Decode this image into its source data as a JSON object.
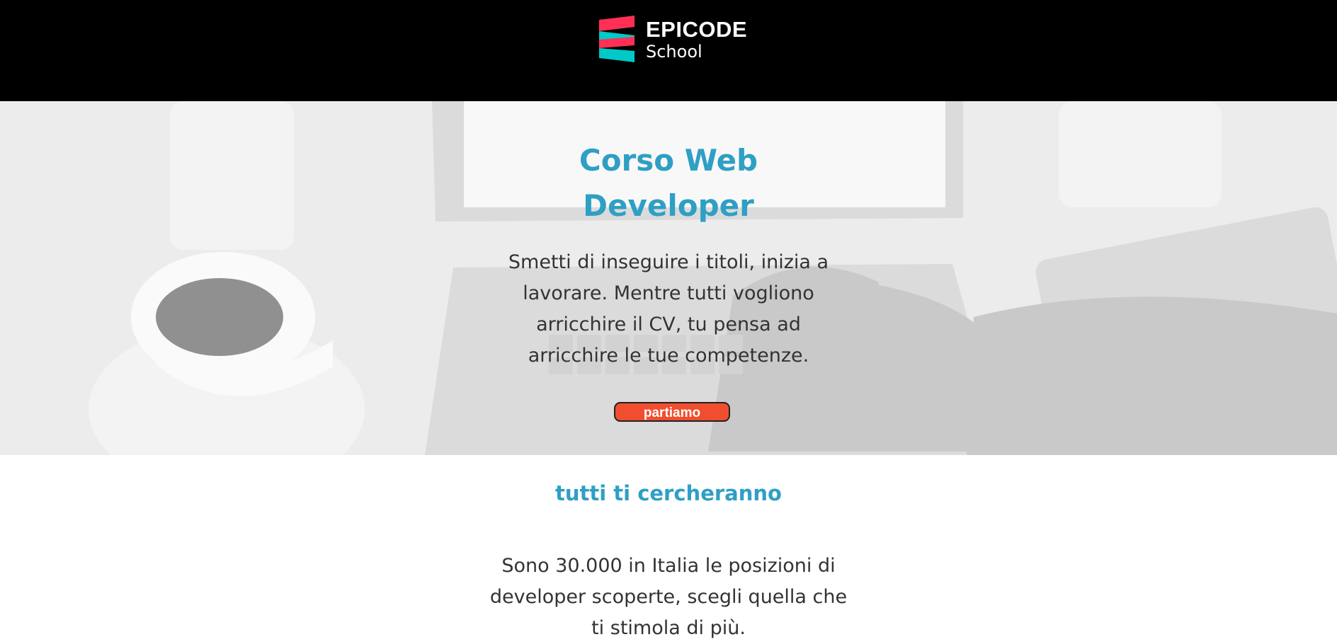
{
  "header": {
    "brand": "EPICODE",
    "subbrand": "School",
    "logo_icon": "epicode-logo-icon",
    "logo_colors": [
      "#ff2f55",
      "#00c9c8"
    ]
  },
  "hero": {
    "title": "Corso Web Developer",
    "description": "Smetti di inseguire i titoli, inizia a lavorare. Mentre tutti vogliono arricchire il CV, tu pensa ad arricchire le tue competenze.",
    "button_label": "partiamo",
    "background_image": "laptop-coffee-desk-photo"
  },
  "section": {
    "title": "tutti ti cercheranno",
    "description": "Sono 30.000 in Italia le posizioni di developer scoperte, scegli quella che ti stimola di più."
  },
  "colors": {
    "header_bg": "#000000",
    "accent": "#2f9fc4",
    "button": "#f04e2f",
    "text": "#333333"
  }
}
